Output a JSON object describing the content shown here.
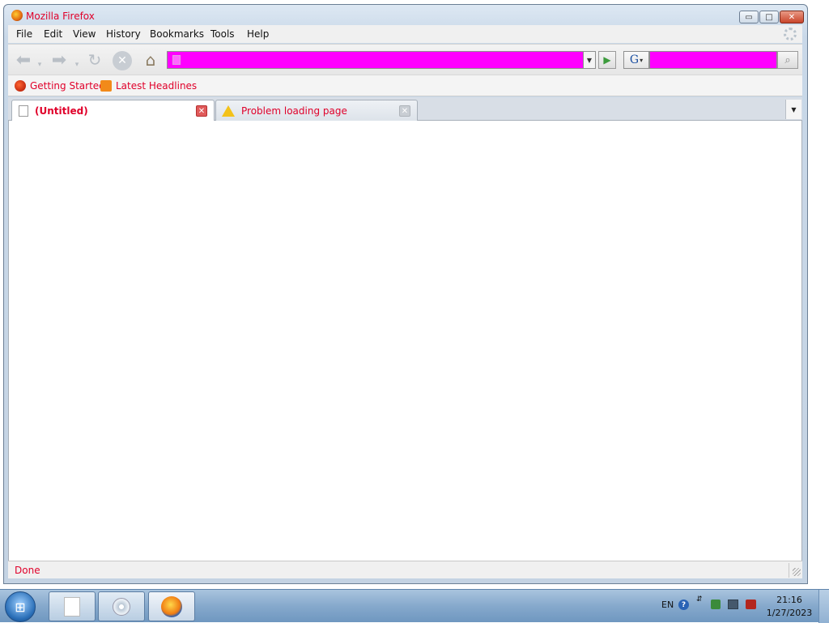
{
  "window": {
    "title": "Mozilla Firefox",
    "controls": {
      "minimize": "▭",
      "maximize": "□",
      "close": "✕"
    }
  },
  "menubar": {
    "items": [
      "File",
      "Edit",
      "View",
      "History",
      "Bookmarks",
      "Tools",
      "Help"
    ]
  },
  "navbar": {
    "back_icon": "arrow-left-icon",
    "forward_icon": "arrow-right-icon",
    "reload_icon": "reload-icon",
    "stop_icon": "stop-icon",
    "home_icon": "home-icon",
    "url_value": "",
    "go_icon": "go-arrow-icon",
    "search_engine_letter": "G",
    "search_value": "",
    "search_icon": "magnifier-icon"
  },
  "bookmarks": {
    "items": [
      "Getting Started",
      "Latest Headlines"
    ]
  },
  "tabs": [
    {
      "label": "(Untitled)",
      "selected": true
    },
    {
      "label": "Problem loading page",
      "selected": false
    }
  ],
  "statusbar": {
    "text": "Done"
  },
  "taskbar": {
    "language": "EN",
    "help_glyph": "?",
    "clock_time": "21:16",
    "clock_date": "1/27/2023"
  },
  "colors": {
    "highlight_magenta": "#ff00ff",
    "title_text_red": "#e0002a"
  }
}
